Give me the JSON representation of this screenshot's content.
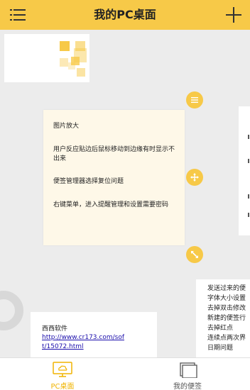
{
  "header": {
    "title": "我的PC桌面",
    "menu_icon": "menu-icon",
    "add_icon": "plus-icon"
  },
  "notes": {
    "main": {
      "lines": [
        "图片放大",
        "用户反应贴边后鼠标移动到边缘有时显示不出来",
        "便签管理器选择复位问题",
        "右键菜单，进入提醒管理和设置需要密码"
      ]
    },
    "link_note": {
      "title": "西西软件",
      "url": "http://www.cr173.com/soft/15072.html"
    },
    "right_note": {
      "lines": [
        "发送过来的便",
        "字体大小设置",
        "去掉双击修改",
        "新建的便签行",
        "去掉红点",
        "连续点两次界",
        "日期问题"
      ]
    }
  },
  "controls": {
    "menu_handle_icon": "list-icon",
    "move_handle_icon": "move-arrows-icon",
    "resize_handle_icon": "resize-diagonal-icon"
  },
  "tabbar": {
    "tabs": [
      {
        "label": "PC桌面",
        "icon": "monitor-cloud-icon",
        "active": true
      },
      {
        "label": "我的便签",
        "icon": "stacked-notes-icon",
        "active": false
      }
    ]
  },
  "colors": {
    "accent": "#f7c948",
    "active_tab": "#f0b400",
    "inactive_tab": "#555555",
    "note_bg": "#fef8e8"
  }
}
